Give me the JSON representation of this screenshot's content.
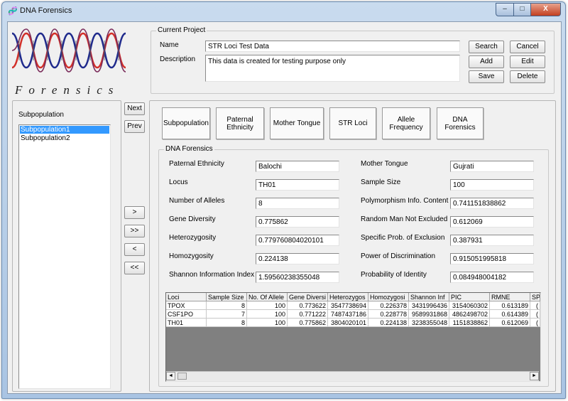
{
  "window": {
    "title": "DNA Forensics",
    "controls": {
      "minimize": "–",
      "maximize": "□",
      "close": "X"
    }
  },
  "logo": {
    "text": "Forensics"
  },
  "project": {
    "group_label": "Current Project",
    "name_label": "Name",
    "name_value": "STR Loci Test Data",
    "description_label": "Description",
    "description_value": "This data is created for testing purpose only",
    "buttons": {
      "search": "Search",
      "cancel": "Cancel",
      "add": "Add",
      "edit": "Edit",
      "save": "Save",
      "delete": "Delete"
    }
  },
  "subpop_panel": {
    "title": "Subpopulation",
    "items": [
      "Subpopulation1",
      "Subpopulation2"
    ],
    "selected_index": 0
  },
  "nav": {
    "next": "Next",
    "prev": "Prev",
    "add_one": ">",
    "add_all": ">>",
    "remove_one": "<",
    "remove_all": "<<"
  },
  "tabs": [
    "Subpopulation",
    "Paternal\nEthnicity",
    "Mother Tongue",
    "STR Loci",
    "Allele\nFrequency",
    "DNA\nForensics"
  ],
  "forensics": {
    "group_label": "DNA Forensics",
    "left": [
      {
        "label": "Paternal Ethnicity",
        "value": "Balochi"
      },
      {
        "label": "Locus",
        "value": "TH01"
      },
      {
        "label": "Number of Alleles",
        "value": "8"
      },
      {
        "label": "Gene Diversity",
        "value": "0.775862"
      },
      {
        "label": "Heterozygosity",
        "value": "0.779760804020101"
      },
      {
        "label": "Homozygosity",
        "value": "0.224138"
      },
      {
        "label": "Shannon Information Index",
        "value": "1.59560238355048"
      }
    ],
    "right": [
      {
        "label": "Mother Tongue",
        "value": "Gujrati"
      },
      {
        "label": "Sample Size",
        "value": "100"
      },
      {
        "label": "Polymorphism Info. Content",
        "value": "0.741151838862"
      },
      {
        "label": "Random Man Not Excluded",
        "value": "0.612069"
      },
      {
        "label": "Specific Prob. of Exclusion",
        "value": "0.387931"
      },
      {
        "label": "Power of Discrimination",
        "value": "0.915051995818"
      },
      {
        "label": "Probability of Identity",
        "value": "0.084948004182"
      }
    ]
  },
  "table": {
    "headers": [
      "Loci",
      "Sample Size",
      "No. Of Allele",
      "Gene Diversi",
      "Heterozygos",
      "Homozygosi",
      "Shannon Inf",
      "PIC",
      "RMNE",
      "SPI"
    ],
    "rows": [
      [
        "TPOX",
        "8",
        "100",
        "0.773622",
        "3547738694",
        "0.226378",
        "3431996436",
        "3154060302",
        "0.613189",
        "("
      ],
      [
        "CSF1PO",
        "7",
        "100",
        "0.771222",
        "7487437186",
        "0.228778",
        "9589931868",
        "4862498702",
        "0.614389",
        "("
      ],
      [
        "TH01",
        "8",
        "100",
        "0.775862",
        "3804020101",
        "0.224138",
        "3238355048",
        "1151838862",
        "0.612069",
        "("
      ]
    ]
  },
  "scroll": {
    "left_arrow": "◄",
    "right_arrow": "►"
  }
}
